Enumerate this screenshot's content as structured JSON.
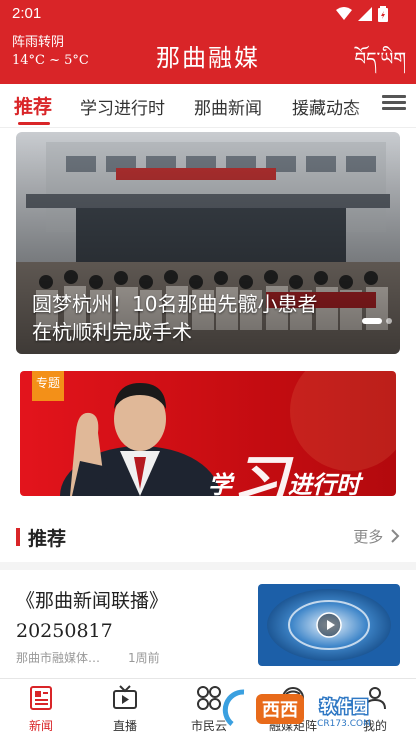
{
  "status_bar": {
    "time": "2:01"
  },
  "header": {
    "weather": "阵雨转阴",
    "temperature": "14°C ~ 5°C",
    "title": "那曲融媒",
    "tibetan_label": "བོད་ཡིག"
  },
  "tabs": [
    {
      "label": "推荐",
      "active": true
    },
    {
      "label": "学习进行时",
      "active": false
    },
    {
      "label": "那曲新闻",
      "active": false
    },
    {
      "label": "援藏动态",
      "active": false
    }
  ],
  "banner": {
    "caption_line1": "圆梦杭州！10名那曲先髋小患者",
    "caption_line2": "在杭顺利完成手术",
    "slide_count": 2,
    "active_slide": 1
  },
  "topic_card": {
    "badge": "专题",
    "text_big": "学",
    "text_big2": "习",
    "text_rest": "进行时"
  },
  "section": {
    "title": "推荐",
    "more_label": "更多"
  },
  "news": [
    {
      "title_line1": "《那曲新闻联播》",
      "title_line2": "20250817",
      "source": "那曲市融媒体…",
      "time": "1周前",
      "thumbnail_icon": "play-icon"
    }
  ],
  "bottom_nav": [
    {
      "label": "新闻",
      "icon": "news-icon",
      "active": true
    },
    {
      "label": "直播",
      "icon": "tv-icon",
      "active": false
    },
    {
      "label": "市民云",
      "icon": "cloud-icon",
      "active": false
    },
    {
      "label": "融媒矩阵",
      "icon": "matrix-icon",
      "active": false
    },
    {
      "label": "我的",
      "icon": "user-icon",
      "active": false
    }
  ],
  "watermark": {
    "brand": "西西",
    "sub": "软件园",
    "url": "CR173.COM"
  },
  "colors": {
    "brand_red": "#d92528",
    "accent_orange": "#f39018",
    "text_gray": "#999999"
  }
}
